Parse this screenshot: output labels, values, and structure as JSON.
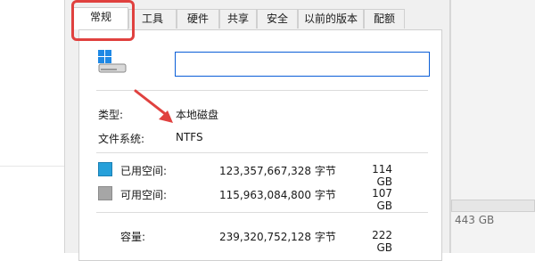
{
  "background": {
    "size_text": "443 GB"
  },
  "tabs": [
    {
      "label": "常规",
      "active": true
    },
    {
      "label": "工具",
      "active": false
    },
    {
      "label": "硬件",
      "active": false
    },
    {
      "label": "共享",
      "active": false
    },
    {
      "label": "安全",
      "active": false
    },
    {
      "label": "以前的版本",
      "active": false
    },
    {
      "label": "配额",
      "active": false
    }
  ],
  "general": {
    "drive_name_value": "",
    "type_label": "类型:",
    "type_value": "本地磁盘",
    "fs_label": "文件系统:",
    "fs_value": "NTFS"
  },
  "space": {
    "used": {
      "label": "已用空间:",
      "bytes": "123,357,667,328 字节",
      "gb": "114 GB",
      "color": "#26a0da"
    },
    "free": {
      "label": "可用空间:",
      "bytes": "115,963,084,800 字节",
      "gb": "107 GB",
      "color": "#a6a6a6"
    },
    "capacity": {
      "label": "容量:",
      "bytes": "239,320,752,128 字节",
      "gb": "222 GB"
    }
  },
  "annotation_color": "#e0413f"
}
